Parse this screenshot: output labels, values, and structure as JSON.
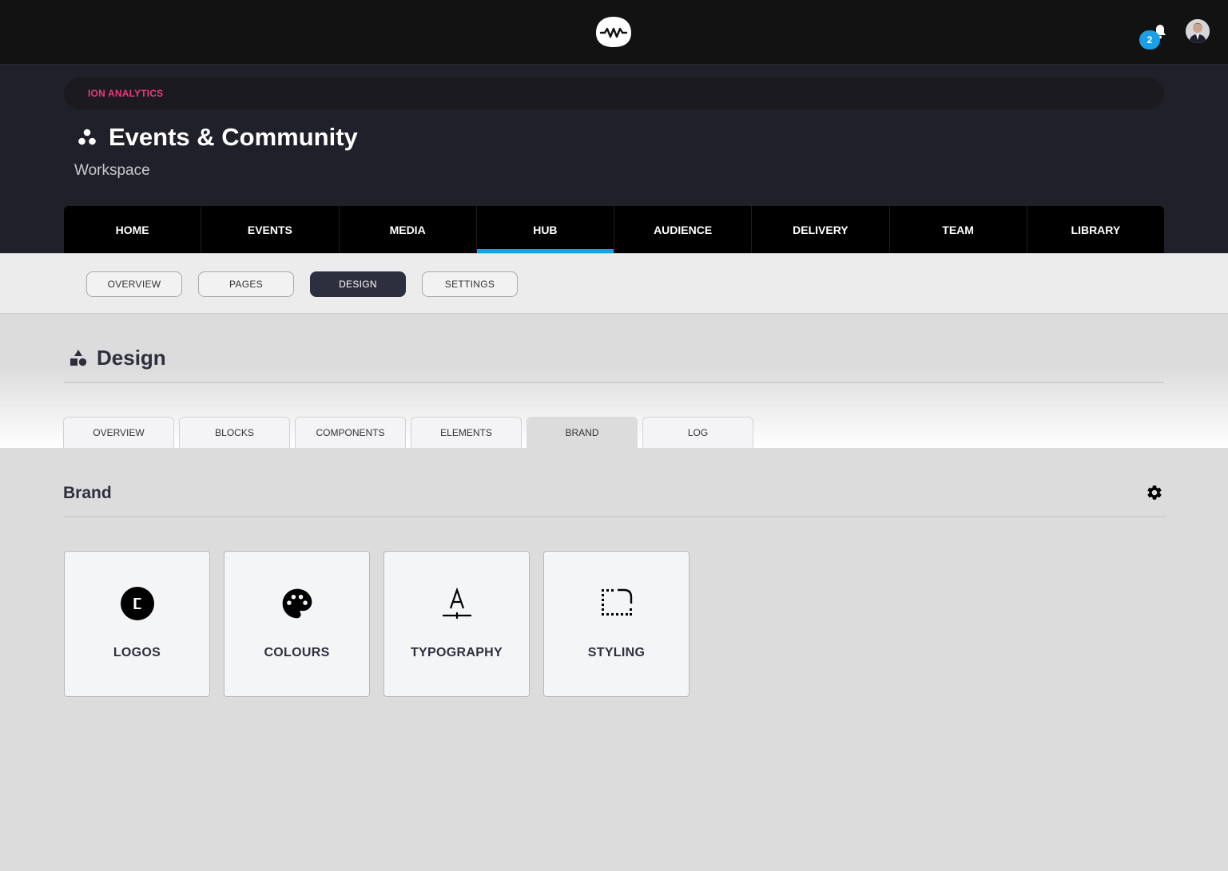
{
  "topbar": {
    "logo_icon": "waveform-logo-icon",
    "notification_icon": "bell-icon",
    "notification_count": "2",
    "avatar": "user-avatar"
  },
  "workspace": {
    "breadcrumb": "ION ANALYTICS",
    "title_icon": "community-icon",
    "title": "Events & Community",
    "subtitle": "Workspace"
  },
  "main_nav": {
    "items": [
      {
        "label": "HOME"
      },
      {
        "label": "EVENTS"
      },
      {
        "label": "MEDIA"
      },
      {
        "label": "HUB",
        "active": true
      },
      {
        "label": "AUDIENCE"
      },
      {
        "label": "DELIVERY"
      },
      {
        "label": "TEAM"
      },
      {
        "label": "LIBRARY"
      }
    ],
    "active_color": "#1aa0e8"
  },
  "sub_nav": {
    "items": [
      {
        "label": "OVERVIEW"
      },
      {
        "label": "PAGES"
      },
      {
        "label": "DESIGN",
        "active": true
      },
      {
        "label": "SETTINGS"
      }
    ]
  },
  "design": {
    "title_icon": "shapes-icon",
    "title": "Design",
    "tabs": [
      {
        "label": "OVERVIEW"
      },
      {
        "label": "BLOCKS"
      },
      {
        "label": "COMPONENTS"
      },
      {
        "label": "ELEMENTS"
      },
      {
        "label": "BRAND",
        "active": true
      },
      {
        "label": "LOG"
      }
    ]
  },
  "brand": {
    "title": "Brand",
    "settings_icon": "gear-icon",
    "cards": [
      {
        "label": "LOGOS",
        "icon": "copyright-icon"
      },
      {
        "label": "COLOURS",
        "icon": "palette-icon"
      },
      {
        "label": "TYPOGRAPHY",
        "icon": "text-format-icon"
      },
      {
        "label": "STYLING",
        "icon": "rounded-corner-icon"
      }
    ]
  },
  "colors": {
    "brand_pink": "#f0387f",
    "accent_blue": "#1aa0e8",
    "dark_active": "#2d2f3e"
  }
}
